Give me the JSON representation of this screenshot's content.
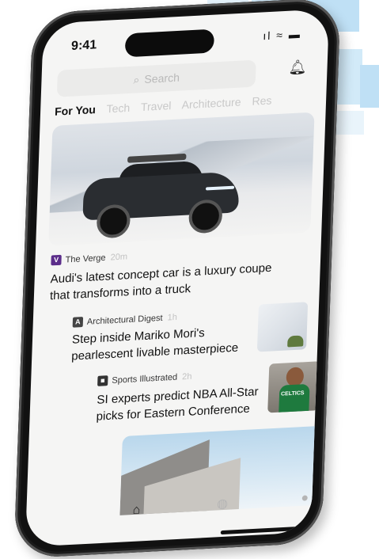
{
  "status_bar": {
    "time": "9:41",
    "icons": "… ● ▬"
  },
  "search": {
    "placeholder": "Search",
    "icon": "search-icon"
  },
  "header": {
    "bell_icon": "bell-icon"
  },
  "tabs": [
    {
      "label": "For You",
      "active": true
    },
    {
      "label": "Tech"
    },
    {
      "label": "Travel"
    },
    {
      "label": "Architecture"
    },
    {
      "label": "Res"
    }
  ],
  "articles": [
    {
      "source": "The Verge",
      "time": "20m",
      "headline": "Audi's latest concept car is a luxury coupe that transforms into a truck",
      "logo_color": "#5b2d8a"
    },
    {
      "source": "Architectural Digest",
      "time": "1h",
      "headline": "Step inside Mariko Mori's pearlescent livable masterpiece",
      "logo_color": "#444444"
    },
    {
      "source": "Sports Illustrated",
      "time": "2h",
      "headline": "SI experts predict NBA All-Star picks for Eastern Conference",
      "logo_color": "#333333"
    }
  ],
  "thumb3_jersey": "CELTICS",
  "bottom_nav": [
    "home-icon",
    "globe-icon",
    "profile-icon"
  ]
}
